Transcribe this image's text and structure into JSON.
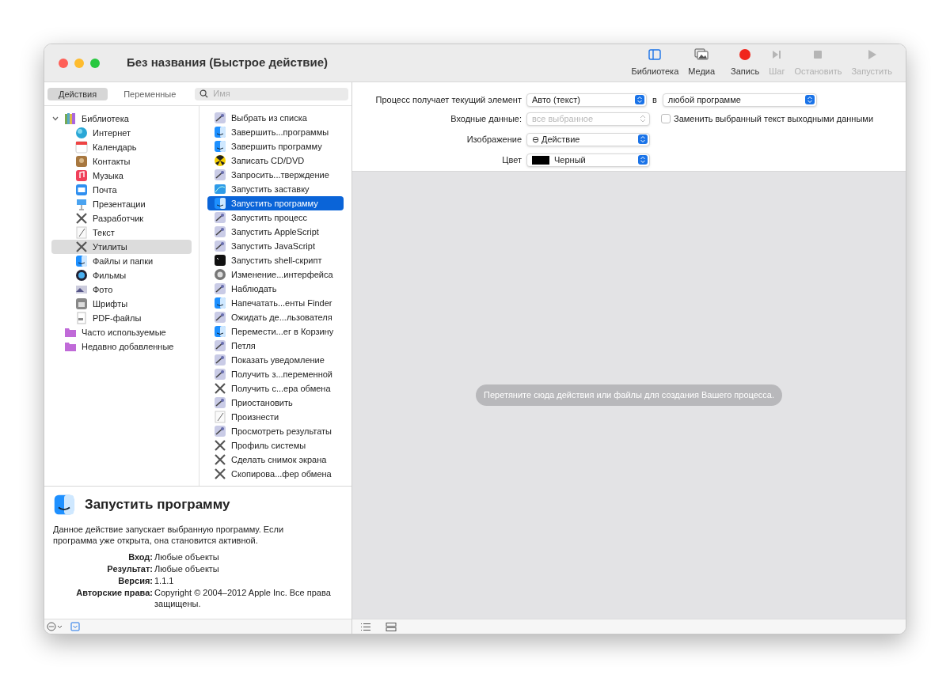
{
  "window": {
    "title": "Без названия (Быстрое действие)"
  },
  "toolbar": [
    {
      "label": "Библиотека",
      "disabled": false
    },
    {
      "label": "Медиа",
      "disabled": false
    },
    {
      "label": "Запись",
      "disabled": false
    },
    {
      "label": "Шаг",
      "disabled": true
    },
    {
      "label": "Остановить",
      "disabled": true
    },
    {
      "label": "Запустить",
      "disabled": true
    }
  ],
  "sidebar_tabs": [
    {
      "label": "Действия",
      "selected": true
    },
    {
      "label": "Переменные",
      "selected": false
    }
  ],
  "search": {
    "placeholder": "Имя"
  },
  "library": [
    {
      "label": "Библиотека",
      "expanded": true,
      "selected": false,
      "children": [
        {
          "label": "Интернет",
          "selected": false
        },
        {
          "label": "Календарь",
          "selected": false
        },
        {
          "label": "Контакты",
          "selected": false
        },
        {
          "label": "Музыка",
          "selected": false
        },
        {
          "label": "Почта",
          "selected": false
        },
        {
          "label": "Презентации",
          "selected": false
        },
        {
          "label": "Разработчик",
          "selected": false
        },
        {
          "label": "Текст",
          "selected": false
        },
        {
          "label": "Утилиты",
          "selected": true
        },
        {
          "label": "Файлы и папки",
          "selected": false
        },
        {
          "label": "Фильмы",
          "selected": false
        },
        {
          "label": "Фото",
          "selected": false
        },
        {
          "label": "Шрифты",
          "selected": false
        },
        {
          "label": "PDF-файлы",
          "selected": false
        }
      ]
    },
    {
      "label": "Часто используемые",
      "selected": false
    },
    {
      "label": "Недавно добавленные",
      "selected": false
    }
  ],
  "actions": [
    {
      "label": "Выбрать из списка",
      "selected": false
    },
    {
      "label": "Завершить...программы",
      "selected": false
    },
    {
      "label": "Завершить программу",
      "selected": false
    },
    {
      "label": "Записать CD/DVD",
      "selected": false
    },
    {
      "label": "Запросить...тверждение",
      "selected": false
    },
    {
      "label": "Запустить заставку",
      "selected": false
    },
    {
      "label": "Запустить программу",
      "selected": true
    },
    {
      "label": "Запустить процесс",
      "selected": false
    },
    {
      "label": "Запустить AppleScript",
      "selected": false
    },
    {
      "label": "Запустить JavaScript",
      "selected": false
    },
    {
      "label": "Запустить shell-скрипт",
      "selected": false
    },
    {
      "label": "Изменение...интерфейса",
      "selected": false
    },
    {
      "label": "Наблюдать",
      "selected": false
    },
    {
      "label": "Напечатать...енты Finder",
      "selected": false
    },
    {
      "label": "Ожидать де...льзователя",
      "selected": false
    },
    {
      "label": "Перемести...ег в Корзину",
      "selected": false
    },
    {
      "label": "Петля",
      "selected": false
    },
    {
      "label": "Показать уведомление",
      "selected": false
    },
    {
      "label": "Получить з...переменной",
      "selected": false
    },
    {
      "label": "Получить с...ера обмена",
      "selected": false
    },
    {
      "label": "Приостановить",
      "selected": false
    },
    {
      "label": "Произнести",
      "selected": false
    },
    {
      "label": "Просмотреть результаты",
      "selected": false
    },
    {
      "label": "Профиль системы",
      "selected": false
    },
    {
      "label": "Сделать снимок экрана",
      "selected": false
    },
    {
      "label": "Скопирова...фер обмена",
      "selected": false
    }
  ],
  "description": {
    "title": "Запустить программу",
    "text": "Данное действие запускает выбранную программу. Если программа уже открыта, она становится активной.",
    "fields": [
      {
        "label": "Вход:",
        "value": "Любые объекты"
      },
      {
        "label": "Результат:",
        "value": "Любые объекты"
      },
      {
        "label": "Версия:",
        "value": "1.1.1"
      },
      {
        "label": "Авторские права:",
        "value": "Copyright © 2004–2012 Apple Inc. Все права защищены."
      }
    ]
  },
  "settings": {
    "receives_label": "Процесс получает текущий элемент",
    "receives_value": "Авто (текст)",
    "in_label": "в",
    "app_value": "любой программе",
    "input_label": "Входные данные:",
    "input_value": "все выбранное",
    "input_disabled": true,
    "replace": {
      "label": "Заменить выбранный текст выходными данными",
      "checked": false
    },
    "image_label": "Изображение",
    "image_value": "⊖ Действие",
    "color_label": "Цвет",
    "color_value": "Черный",
    "color": "#000000"
  },
  "canvas": {
    "hint": "Перетяните сюда действия или файлы для создания Вашего процесса."
  }
}
